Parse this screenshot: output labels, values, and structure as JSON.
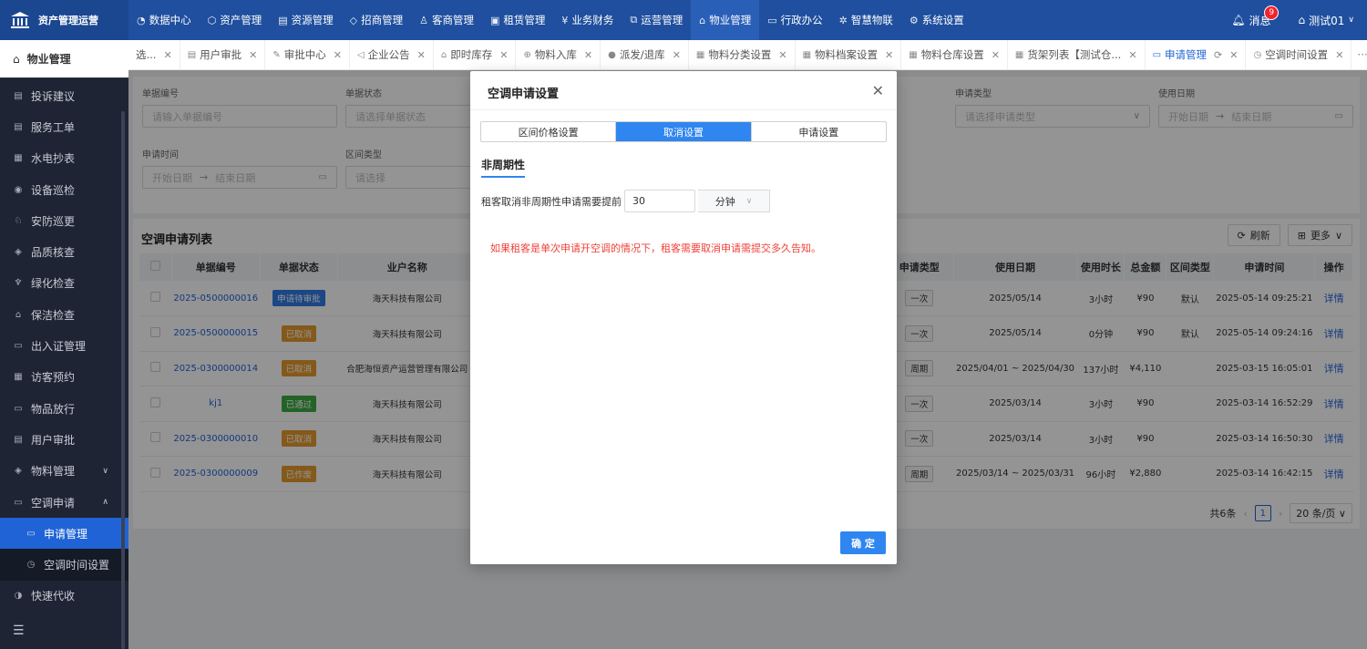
{
  "app": {
    "title": "资产管理运营"
  },
  "topnav": [
    {
      "label": "数据中心",
      "icon": "chart-icon"
    },
    {
      "label": "资产管理",
      "icon": "box-icon"
    },
    {
      "label": "资源管理",
      "icon": "building-icon"
    },
    {
      "label": "招商管理",
      "icon": "tag-icon"
    },
    {
      "label": "客商管理",
      "icon": "users-icon"
    },
    {
      "label": "租赁管理",
      "icon": "lease-icon"
    },
    {
      "label": "业务财务",
      "icon": "finance-icon"
    },
    {
      "label": "运营管理",
      "icon": "ops-icon"
    },
    {
      "label": "物业管理",
      "icon": "home-icon",
      "active": true
    },
    {
      "label": "行政办公",
      "icon": "office-icon"
    },
    {
      "label": "智慧物联",
      "icon": "iot-icon"
    },
    {
      "label": "系统设置",
      "icon": "settings-icon"
    }
  ],
  "topright": {
    "messages_label": "消息",
    "messages_count": "9",
    "user_label": "测试01"
  },
  "sidebar": {
    "header": "物业管理",
    "items": [
      {
        "label": "投诉建议",
        "icon": "complaint-icon"
      },
      {
        "label": "服务工单",
        "icon": "ticket-icon"
      },
      {
        "label": "水电抄表",
        "icon": "meter-icon"
      },
      {
        "label": "设备巡检",
        "icon": "device-icon"
      },
      {
        "label": "安防巡更",
        "icon": "security-icon"
      },
      {
        "label": "品质核查",
        "icon": "quality-icon"
      },
      {
        "label": "绿化检查",
        "icon": "plant-icon"
      },
      {
        "label": "保洁检查",
        "icon": "clean-icon"
      },
      {
        "label": "出入证管理",
        "icon": "pass-icon"
      },
      {
        "label": "访客预约",
        "icon": "visitor-icon"
      },
      {
        "label": "物品放行",
        "icon": "goods-icon"
      },
      {
        "label": "用户审批",
        "icon": "approve-icon"
      },
      {
        "label": "物料管理",
        "icon": "material-icon"
      },
      {
        "label": "空调申请",
        "icon": "ac-icon"
      }
    ],
    "subitems": [
      {
        "label": "申请管理",
        "active": true
      },
      {
        "label": "空调时间设置"
      }
    ],
    "after": {
      "label": "快速代收",
      "icon": "express-icon"
    }
  },
  "tabs": [
    {
      "label": "选...",
      "icon": ""
    },
    {
      "label": "用户审批",
      "icon": "doc-icon"
    },
    {
      "label": "审批中心",
      "icon": "edit-icon"
    },
    {
      "label": "企业公告",
      "icon": "speaker-icon"
    },
    {
      "label": "即时库存",
      "icon": "stock-icon"
    },
    {
      "label": "物料入库",
      "icon": "inbound-icon"
    },
    {
      "label": "派发/退库",
      "icon": "dispatch-icon"
    },
    {
      "label": "物料分类设置",
      "icon": "grid-icon"
    },
    {
      "label": "物料档案设置",
      "icon": "grid-icon"
    },
    {
      "label": "物料仓库设置",
      "icon": "grid-icon"
    },
    {
      "label": "货架列表【测试仓...",
      "icon": "grid-icon"
    },
    {
      "label": "申请管理",
      "icon": "ac-icon",
      "active": true
    },
    {
      "label": "空调时间设置",
      "icon": "clock-icon"
    }
  ],
  "tabs_more": "更多",
  "filters": {
    "doc_no_label": "单据编号",
    "doc_no_placeholder": "请输入单据编号",
    "doc_status_label": "单据状态",
    "doc_status_placeholder": "请选择单据状态",
    "apply_type_label": "申请类型",
    "apply_type_placeholder": "请选择申请类型",
    "use_date_label": "使用日期",
    "use_date_start": "开始日期",
    "use_date_end": "结束日期",
    "apply_time_label": "申请时间",
    "apply_time_start": "开始日期",
    "apply_time_end": "结束日期",
    "zone_type_label": "区间类型",
    "zone_type_placeholder": "请选择"
  },
  "list": {
    "title": "空调申请列表",
    "refresh_label": "刷新",
    "more_label": "更多",
    "columns_left": [
      "单据编号",
      "单据状态",
      "业户名称"
    ],
    "columns_right": [
      "申请类型",
      "使用日期",
      "使用时长",
      "总金额",
      "区间类型",
      "申请时间",
      "操作"
    ],
    "rows": [
      {
        "no": "2025-0500000016",
        "status": "申请待审批",
        "status_color": "blue",
        "tenant": "海天科技有限公司",
        "type": "一次",
        "date": "2025/05/14",
        "duration": "3小时",
        "amount": "¥90",
        "zone": "默认",
        "time": "2025-05-14 09:25:21",
        "op": "详情"
      },
      {
        "no": "2025-0500000015",
        "status": "已取消",
        "status_color": "orange",
        "tenant": "海天科技有限公司",
        "type": "一次",
        "date": "2025/05/14",
        "duration": "0分钟",
        "amount": "¥90",
        "zone": "默认",
        "time": "2025-05-14 09:24:16",
        "op": "详情"
      },
      {
        "no": "2025-0300000014",
        "status": "已取消",
        "status_color": "orange",
        "tenant": "合肥海恒资产运营管理有限公司",
        "type": "周期",
        "date": "2025/04/01 ~ 2025/04/30",
        "duration": "137小时",
        "amount": "¥4,110",
        "zone": "",
        "time": "2025-03-15 16:05:01",
        "op": "详情"
      },
      {
        "no": "kj1",
        "status": "已通过",
        "status_color": "green",
        "tenant": "海天科技有限公司",
        "type": "一次",
        "date": "2025/03/14",
        "duration": "3小时",
        "amount": "¥90",
        "zone": "",
        "time": "2025-03-14 16:52:29",
        "op": "详情"
      },
      {
        "no": "2025-0300000010",
        "status": "已取消",
        "status_color": "orange",
        "tenant": "海天科技有限公司",
        "type": "一次",
        "date": "2025/03/14",
        "duration": "3小时",
        "amount": "¥90",
        "zone": "",
        "time": "2025-03-14 16:50:30",
        "op": "详情"
      },
      {
        "no": "2025-0300000009",
        "status": "已作废",
        "status_color": "orange",
        "tenant": "海天科技有限公司",
        "type": "周期",
        "date": "2025/03/14 ~ 2025/03/31",
        "duration": "96小时",
        "amount": "¥2,880",
        "zone": "",
        "time": "2025-03-14 16:42:15",
        "op": "详情"
      }
    ],
    "pager": {
      "total": "共6条",
      "page": "1",
      "size": "20 条/页"
    }
  },
  "modal": {
    "title": "空调申请设置",
    "tabs": [
      "区间价格设置",
      "取消设置",
      "申请设置"
    ],
    "active_tab": 1,
    "section_title": "非周期性",
    "field_label": "租客取消非周期性申请需要提前",
    "field_value": "30",
    "unit": "分钟",
    "hint": "如果租客是单次申请开空调的情况下，租客需要取消申请需提交多久告知。",
    "ok_label": "确 定"
  }
}
